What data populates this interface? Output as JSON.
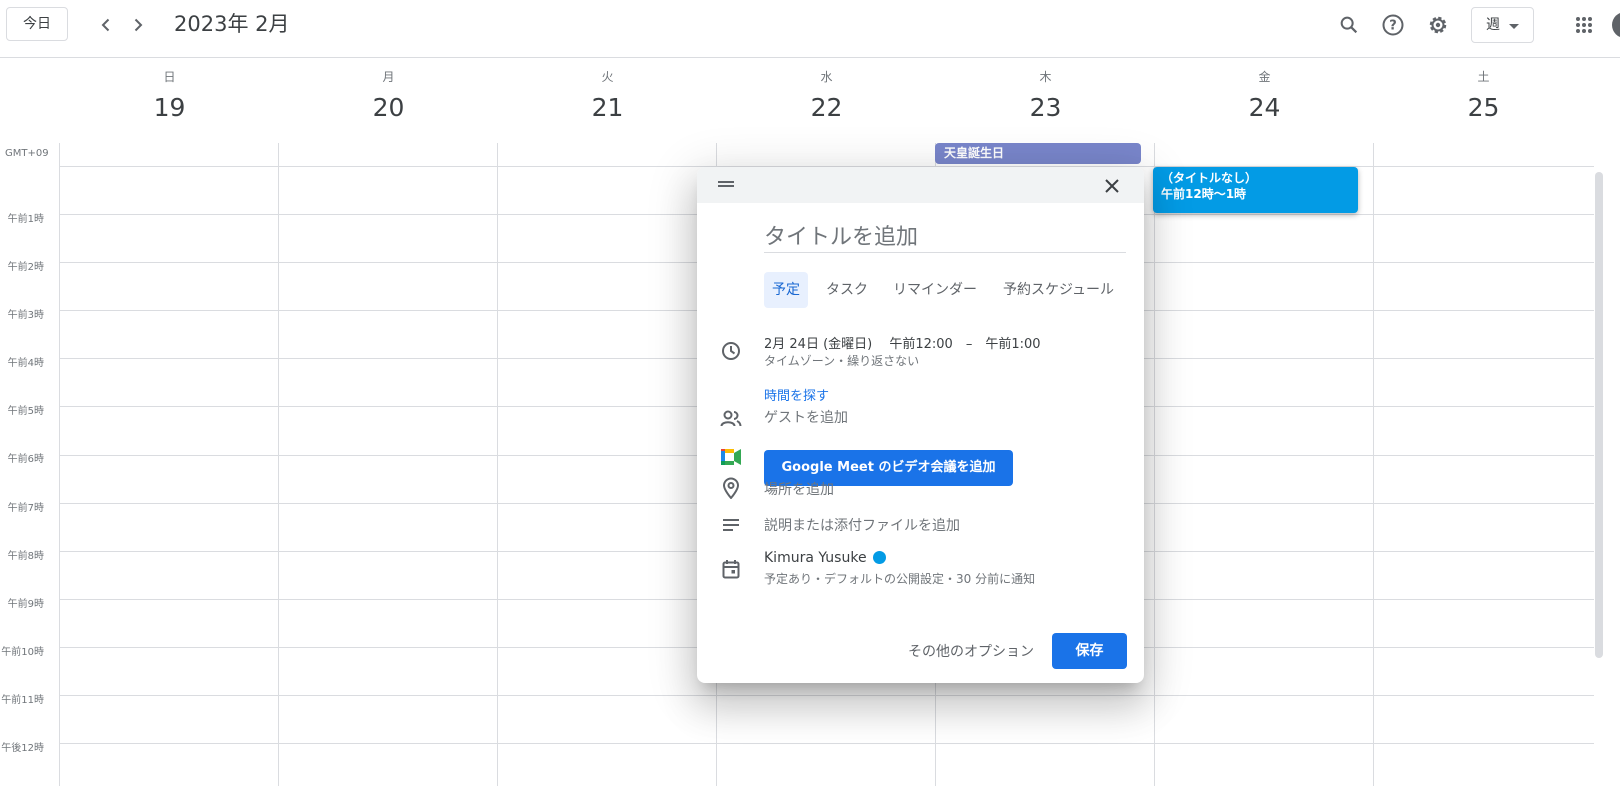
{
  "header": {
    "today_label": "今日",
    "month_title": "2023年 2月",
    "view_label": "週",
    "icons": [
      "chevron-left-icon",
      "chevron-right-icon",
      "search-icon",
      "help-icon",
      "gear-icon",
      "apps-grid-icon"
    ]
  },
  "days": [
    {
      "dow": "日",
      "num": "19"
    },
    {
      "dow": "月",
      "num": "20"
    },
    {
      "dow": "火",
      "num": "21"
    },
    {
      "dow": "水",
      "num": "22"
    },
    {
      "dow": "木",
      "num": "23"
    },
    {
      "dow": "金",
      "num": "24"
    },
    {
      "dow": "土",
      "num": "25"
    }
  ],
  "grid": {
    "timezone": "GMT+09",
    "hours": [
      "午前1時",
      "午前2時",
      "午前3時",
      "午前4時",
      "午前5時",
      "午前6時",
      "午前7時",
      "午前8時",
      "午前9時",
      "午前10時",
      "午前11時",
      "午後12時"
    ]
  },
  "events": {
    "allday": "天皇誕生日",
    "draft_title": "（タイトルなし）",
    "draft_time": "午前12時～1時",
    "allday_color": "#7986cb",
    "draft_color": "#039be5"
  },
  "dialog": {
    "title_placeholder": "タイトルを追加",
    "tabs": [
      "予定",
      "タスク",
      "リマインダー",
      "予約スケジュール"
    ],
    "datetime": "2月 24日 (金曜日)　 午前12:00　–　午前1:00",
    "datetime_sub": "タイムゾーン・繰り返さない",
    "find_time": "時間を探す",
    "add_guests": "ゲストを追加",
    "meet_button": "Google Meet のビデオ会議を追加",
    "add_location": "場所を追加",
    "add_description": "説明または添付ファイルを追加",
    "calendar_owner": "Kimura Yusuke",
    "calendar_sub": "予定あり・デフォルトの公開設定・30 分前に通知",
    "more_options": "その他のオプション",
    "save": "保存",
    "accent_color": "#1a73e8"
  }
}
